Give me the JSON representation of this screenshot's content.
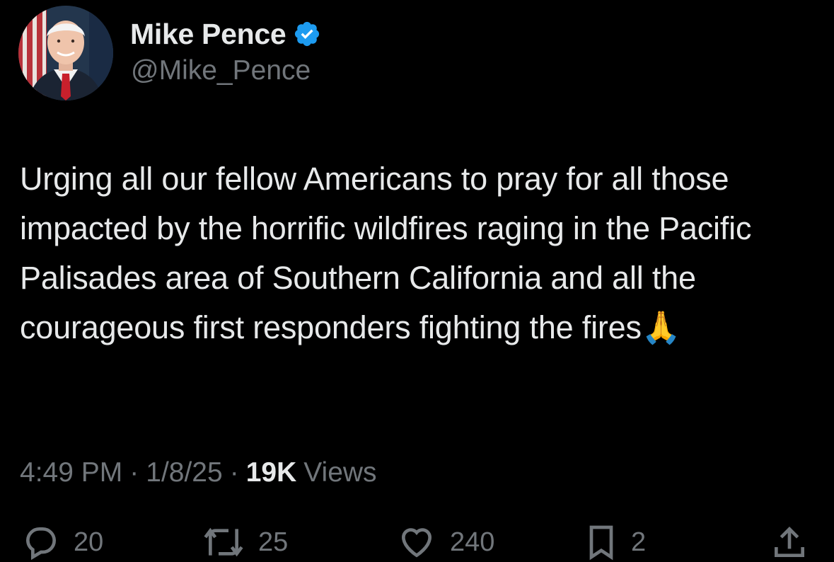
{
  "tweet": {
    "author": {
      "display_name": "Mike Pence",
      "handle": "@Mike_Pence",
      "verified": true
    },
    "text": "Urging all our fellow Americans to pray for all those impacted by the horrific wildfires raging in the Pacific Palisades area of Southern California and all the courageous first responders fighting the fires🙏",
    "time": "4:49 PM",
    "date": "1/8/25",
    "separator": "·",
    "views_count": "19K",
    "views_label": "Views"
  },
  "actions": {
    "reply_count": "20",
    "repost_count": "25",
    "like_count": "240",
    "bookmark_count": "2"
  },
  "icons": {
    "verified": "verified-badge-icon",
    "reply": "reply-icon",
    "repost": "repost-icon",
    "like": "heart-icon",
    "bookmark": "bookmark-icon",
    "share": "share-icon"
  },
  "colors": {
    "background": "#000000",
    "primary_text": "#e7e9ea",
    "secondary_text": "#71767b",
    "verified_blue": "#1d9bf0"
  }
}
